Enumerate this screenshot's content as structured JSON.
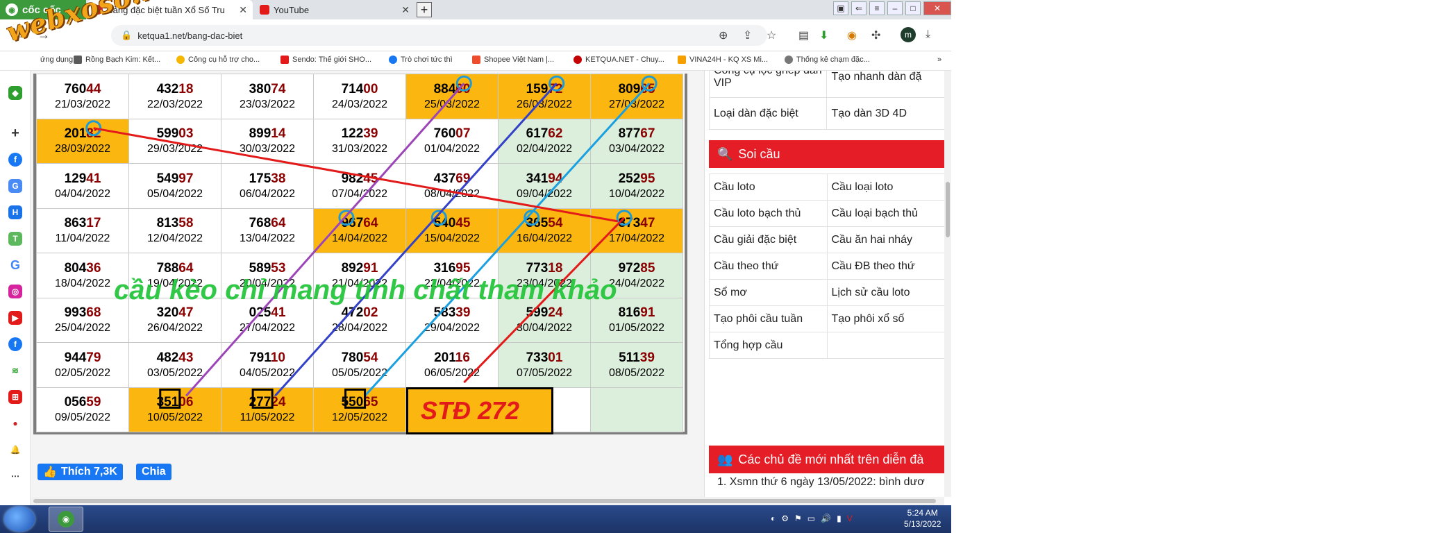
{
  "browser": {
    "brand": "cốc cốc",
    "tabs": [
      {
        "title": "Bảng đặc biệt tuần Xổ Số Tru",
        "active": true
      },
      {
        "title": "YouTube",
        "active": false
      }
    ],
    "url": "ketqua1.net/bang-dac-biet",
    "avatar_letter": "m"
  },
  "watermark": "webxoso.net",
  "bookmarks": [
    {
      "label": "ứng dụng",
      "color": "#ffffff"
    },
    {
      "label": "Rồng Bạch Kim: Kết...",
      "color": "#5a5a5a"
    },
    {
      "label": "Công cụ hỗ trợ cho...",
      "color": "#f5b700"
    },
    {
      "label": "Sendo: Thế giới SHO...",
      "color": "#e31a1a"
    },
    {
      "label": "Trò chơi tức thì",
      "color": "#1877f2"
    },
    {
      "label": "Shopee Việt Nam |...",
      "color": "#ee4d2d"
    },
    {
      "label": "KETQUA.NET - Chuy...",
      "color": "#c40000"
    },
    {
      "label": "VINA24H - KQ XS Mi...",
      "color": "#f5a000"
    },
    {
      "label": "Thống kê chạm đặc...",
      "color": "#777777"
    }
  ],
  "grid": [
    [
      {
        "head": "760",
        "tail": "44",
        "date": "21/03/2022",
        "color": "plain"
      },
      {
        "head": "432",
        "tail": "18",
        "date": "22/03/2022",
        "color": "plain"
      },
      {
        "head": "380",
        "tail": "74",
        "date": "23/03/2022",
        "color": "plain"
      },
      {
        "head": "714",
        "tail": "00",
        "date": "24/03/2022",
        "color": "plain"
      },
      {
        "head": "884",
        "tail": "60",
        "date": "25/03/2022",
        "color": "orange"
      },
      {
        "head": "159",
        "tail": "72",
        "date": "26/03/2022",
        "color": "orange"
      },
      {
        "head": "809",
        "tail": "65",
        "date": "27/03/2022",
        "color": "orange"
      }
    ],
    [
      {
        "head": "201",
        "tail": "82",
        "date": "28/03/2022",
        "color": "orange"
      },
      {
        "head": "599",
        "tail": "03",
        "date": "29/03/2022",
        "color": "plain"
      },
      {
        "head": "899",
        "tail": "14",
        "date": "30/03/2022",
        "color": "plain"
      },
      {
        "head": "122",
        "tail": "39",
        "date": "31/03/2022",
        "color": "plain"
      },
      {
        "head": "760",
        "tail": "07",
        "date": "01/04/2022",
        "color": "plain"
      },
      {
        "head": "617",
        "tail": "62",
        "date": "02/04/2022",
        "color": "green"
      },
      {
        "head": "877",
        "tail": "67",
        "date": "03/04/2022",
        "color": "green"
      }
    ],
    [
      {
        "head": "129",
        "tail": "41",
        "date": "04/04/2022",
        "color": "plain"
      },
      {
        "head": "549",
        "tail": "97",
        "date": "05/04/2022",
        "color": "plain"
      },
      {
        "head": "175",
        "tail": "38",
        "date": "06/04/2022",
        "color": "plain"
      },
      {
        "head": "982",
        "tail": "45",
        "date": "07/04/2022",
        "color": "plain"
      },
      {
        "head": "437",
        "tail": "69",
        "date": "08/04/2022",
        "color": "plain"
      },
      {
        "head": "341",
        "tail": "94",
        "date": "09/04/2022",
        "color": "green"
      },
      {
        "head": "252",
        "tail": "95",
        "date": "10/04/2022",
        "color": "green"
      }
    ],
    [
      {
        "head": "863",
        "tail": "17",
        "date": "11/04/2022",
        "color": "plain"
      },
      {
        "head": "813",
        "tail": "58",
        "date": "12/04/2022",
        "color": "plain"
      },
      {
        "head": "768",
        "tail": "64",
        "date": "13/04/2022",
        "color": "plain"
      },
      {
        "head": "967",
        "tail": "64",
        "date": "14/04/2022",
        "color": "orange"
      },
      {
        "head": "540",
        "tail": "45",
        "date": "15/04/2022",
        "color": "orange"
      },
      {
        "head": "365",
        "tail": "54",
        "date": "16/04/2022",
        "color": "orange"
      },
      {
        "head": "873",
        "tail": "47",
        "date": "17/04/2022",
        "color": "orange"
      }
    ],
    [
      {
        "head": "804",
        "tail": "36",
        "date": "18/04/2022",
        "color": "plain"
      },
      {
        "head": "788",
        "tail": "64",
        "date": "19/04/2022",
        "color": "plain"
      },
      {
        "head": "589",
        "tail": "53",
        "date": "20/04/2022",
        "color": "plain"
      },
      {
        "head": "892",
        "tail": "91",
        "date": "21/04/2022",
        "color": "plain"
      },
      {
        "head": "316",
        "tail": "95",
        "date": "22/04/2022",
        "color": "plain"
      },
      {
        "head": "773",
        "tail": "18",
        "date": "23/04/2022",
        "color": "green"
      },
      {
        "head": "972",
        "tail": "85",
        "date": "24/04/2022",
        "color": "green"
      }
    ],
    [
      {
        "head": "993",
        "tail": "68",
        "date": "25/04/2022",
        "color": "plain"
      },
      {
        "head": "320",
        "tail": "47",
        "date": "26/04/2022",
        "color": "plain"
      },
      {
        "head": "025",
        "tail": "41",
        "date": "27/04/2022",
        "color": "plain"
      },
      {
        "head": "472",
        "tail": "02",
        "date": "28/04/2022",
        "color": "plain"
      },
      {
        "head": "583",
        "tail": "39",
        "date": "29/04/2022",
        "color": "plain"
      },
      {
        "head": "599",
        "tail": "24",
        "date": "30/04/2022",
        "color": "green"
      },
      {
        "head": "816",
        "tail": "91",
        "date": "01/05/2022",
        "color": "green"
      }
    ],
    [
      {
        "head": "944",
        "tail": "79",
        "date": "02/05/2022",
        "color": "plain"
      },
      {
        "head": "482",
        "tail": "43",
        "date": "03/05/2022",
        "color": "plain"
      },
      {
        "head": "791",
        "tail": "10",
        "date": "04/05/2022",
        "color": "plain"
      },
      {
        "head": "780",
        "tail": "54",
        "date": "05/05/2022",
        "color": "plain"
      },
      {
        "head": "201",
        "tail": "16",
        "date": "06/05/2022",
        "color": "plain"
      },
      {
        "head": "733",
        "tail": "01",
        "date": "07/05/2022",
        "color": "green"
      },
      {
        "head": "511",
        "tail": "39",
        "date": "08/05/2022",
        "color": "green"
      }
    ],
    [
      {
        "head": "056",
        "tail": "59",
        "date": "09/05/2022",
        "color": "plain"
      },
      {
        "head": "351",
        "tail": "06",
        "date": "10/05/2022",
        "color": "orange"
      },
      {
        "head": "277",
        "tail": "24",
        "date": "11/05/2022",
        "color": "orange"
      },
      {
        "head": "550",
        "tail": "65",
        "date": "12/05/2022",
        "color": "orange"
      },
      {
        "head": "",
        "tail": "",
        "date": "",
        "color": "plain"
      },
      {
        "head": "",
        "tail": "",
        "date": "",
        "color": "plain"
      },
      {
        "head": "",
        "tail": "",
        "date": "",
        "color": "green"
      }
    ]
  ],
  "std_label": "STĐ 272",
  "note": "cầu kèo chỉ mang tính chất tham khảo",
  "social": {
    "like": "Thích 7,3K",
    "share": "Chia"
  },
  "right_panel": {
    "top_rows": [
      [
        "Công cụ lọc ghép dàn VIP",
        "Tạo nhanh dàn đặ"
      ],
      [
        "Loại dàn đặc biệt",
        "Tạo dàn 3D 4D"
      ]
    ],
    "soi_cau_title": "Soi cầu",
    "soi_cau_rows": [
      [
        "Cầu loto",
        "Cầu loại loto"
      ],
      [
        "Cầu loto bạch thủ",
        "Cầu loại bạch thủ"
      ],
      [
        "Cầu giải đặc biệt",
        "Cầu ăn hai nháy"
      ],
      [
        "Cầu theo thứ",
        "Cầu ĐB theo thứ"
      ],
      [
        "Sổ mơ",
        "Lịch sử cầu loto"
      ],
      [
        "Tạo phôi cầu tuần",
        "Tạo phôi xổ số"
      ],
      [
        "Tổng hợp cầu",
        ""
      ]
    ],
    "forum_title": "Các chủ đề mới nhất trên diễn đà",
    "forum_item": "1. Xsmn thứ 6 ngày 13/05/2022: bình dươ"
  },
  "taskbar": {
    "time": "5:24 AM",
    "date": "5/13/2022"
  }
}
